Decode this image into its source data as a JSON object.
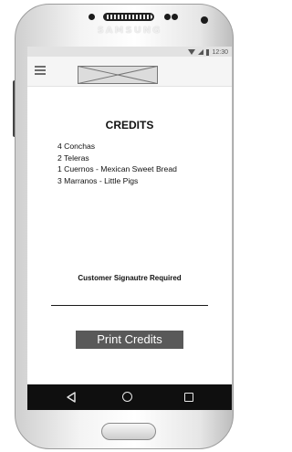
{
  "device": {
    "brand": "SAMSUNG"
  },
  "status_bar": {
    "time": "12:30",
    "icons": [
      "wifi-icon",
      "signal-icon",
      "battery-icon"
    ]
  },
  "app_bar": {
    "menu_icon": "hamburger-menu-icon",
    "logo": "logo-image-placeholder"
  },
  "credits": {
    "title": "CREDITS",
    "items": [
      "4 Conchas",
      "2 Teleras",
      "1 Cuernos - Mexican Sweet Bread",
      "3 Marranos - Little Pigs"
    ]
  },
  "signature": {
    "label": "Customer Signautre Required"
  },
  "actions": {
    "print_label": "Print Credits",
    "print_color": "#595959"
  },
  "nav_bar": {
    "icons": [
      "back-icon",
      "home-icon",
      "recent-apps-icon"
    ],
    "color": "#0f0f0f"
  }
}
